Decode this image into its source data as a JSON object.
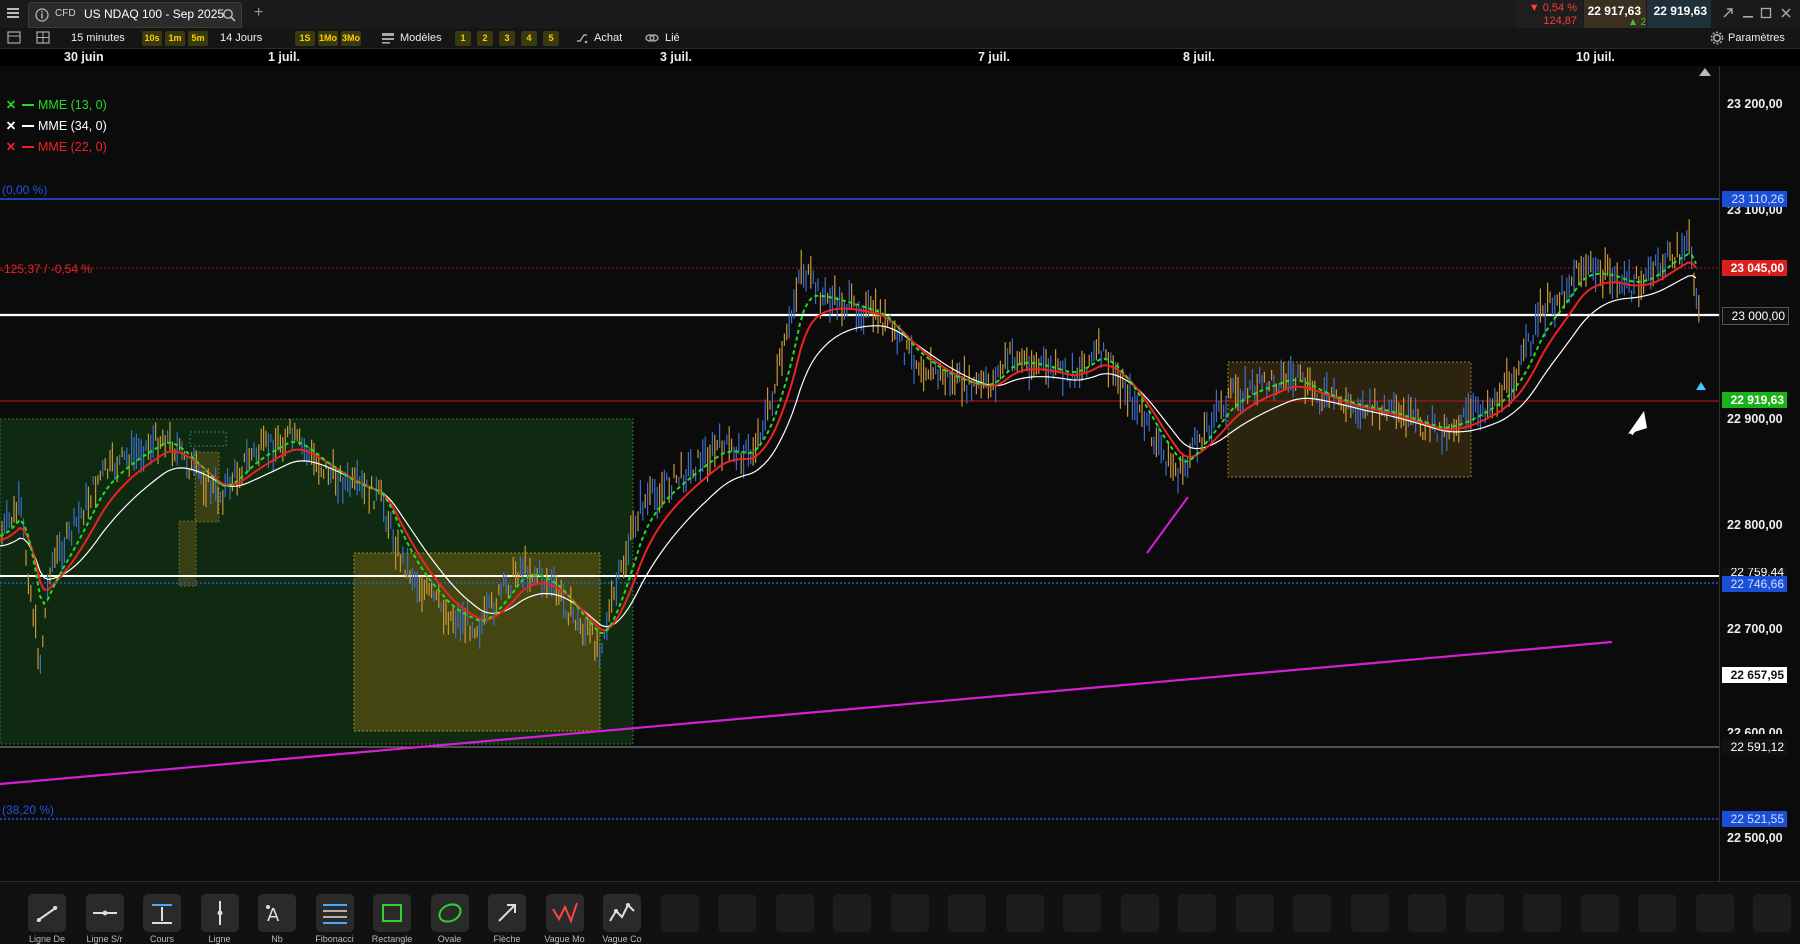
{
  "header": {
    "menu_icon": "hamburger-icon",
    "tab_badge": "CFD",
    "tab_title": "US NDAQ 100 - Sep 2025",
    "add_tab": "+",
    "change_pct": "▼ 0,54 %",
    "change_pts": "124,87",
    "bid": "22 917,63",
    "spread": "▲ 2,00",
    "ask": "22 919,63"
  },
  "toolbar": {
    "interval": "15 minutes",
    "quick_intervals": [
      "10s",
      "1m",
      "5m"
    ],
    "range": "14 Jours",
    "quick_ranges": [
      "1S",
      "1Mo",
      "3Mo"
    ],
    "models": "Modèles",
    "numbers": [
      "1",
      "2",
      "3",
      "4",
      "5"
    ],
    "buy": "Achat",
    "linked": "Lié",
    "settings": "Paramètres"
  },
  "dates": [
    "30 juin",
    "1 juil.",
    "3 juil.",
    "7 juil.",
    "8 juil.",
    "10 juil."
  ],
  "legend": [
    {
      "label": "MME (13, 0)",
      "color": "#22dd22",
      "x_color": "#22dd22"
    },
    {
      "label": "MME (34, 0)",
      "color": "#ffffff",
      "x_color": "#ffffff"
    },
    {
      "label": "MME (22, 0)",
      "color": "#ee2222",
      "x_color": "#ee2222"
    }
  ],
  "annotations": {
    "fib_top": "(0,00 %)",
    "fib_bottom": "(38,20 %)",
    "variation": "-125,37 / -0,54 %"
  },
  "price_axis": {
    "ticks": [
      "23 200,00",
      "23 100,00",
      "23 000,00",
      "22 900,00",
      "22 800,00",
      "22 700,00",
      "22 600,00",
      "22 500,00"
    ],
    "labels": [
      {
        "text": "23 110,26",
        "bg": "#1a4fd6",
        "fg": "#cfe0ff"
      },
      {
        "text": "23 045,00",
        "bg": "#d91e1e",
        "fg": "#ffffff"
      },
      {
        "text": "23 000,00",
        "bg": "#111111",
        "fg": "#ffffff"
      },
      {
        "text": "22 919,63",
        "bg": "#19b219",
        "fg": "#ffffff"
      },
      {
        "text": "22 759,44",
        "bg": "#111111",
        "fg": "#ffffff"
      },
      {
        "text": "22 746,66",
        "bg": "#1a4fd6",
        "fg": "#cfe0ff"
      },
      {
        "text": "22 657,95",
        "bg": "#ffffff",
        "fg": "#111111"
      },
      {
        "text": "22 591,12",
        "bg": "#111111",
        "fg": "#ffffff"
      },
      {
        "text": "22 521,55",
        "bg": "#1a4fd6",
        "fg": "#cfe0ff"
      }
    ]
  },
  "drawing_tools": [
    {
      "label": "Ligne De",
      "icon": "trend-line-icon"
    },
    {
      "label": "Ligne S/r",
      "icon": "horizontal-line-icon"
    },
    {
      "label": "Cours",
      "icon": "price-level-icon"
    },
    {
      "label": "Ligne",
      "icon": "vertical-line-icon"
    },
    {
      "label": "Nb",
      "icon": "text-note-icon"
    },
    {
      "label": "Fibonacci",
      "icon": "fibonacci-icon"
    },
    {
      "label": "Rectangle",
      "icon": "rectangle-icon"
    },
    {
      "label": "Ovale",
      "icon": "oval-icon"
    },
    {
      "label": "Flèche",
      "icon": "arrow-icon"
    },
    {
      "label": "Vague Mo",
      "icon": "wave-icon"
    },
    {
      "label": "Vague Co",
      "icon": "wave-corrective-icon"
    }
  ],
  "colors": {
    "bull": "#22dd22",
    "bear": "#ee2222",
    "accent": "#1a4fd6",
    "trend": "#d61ed6"
  }
}
